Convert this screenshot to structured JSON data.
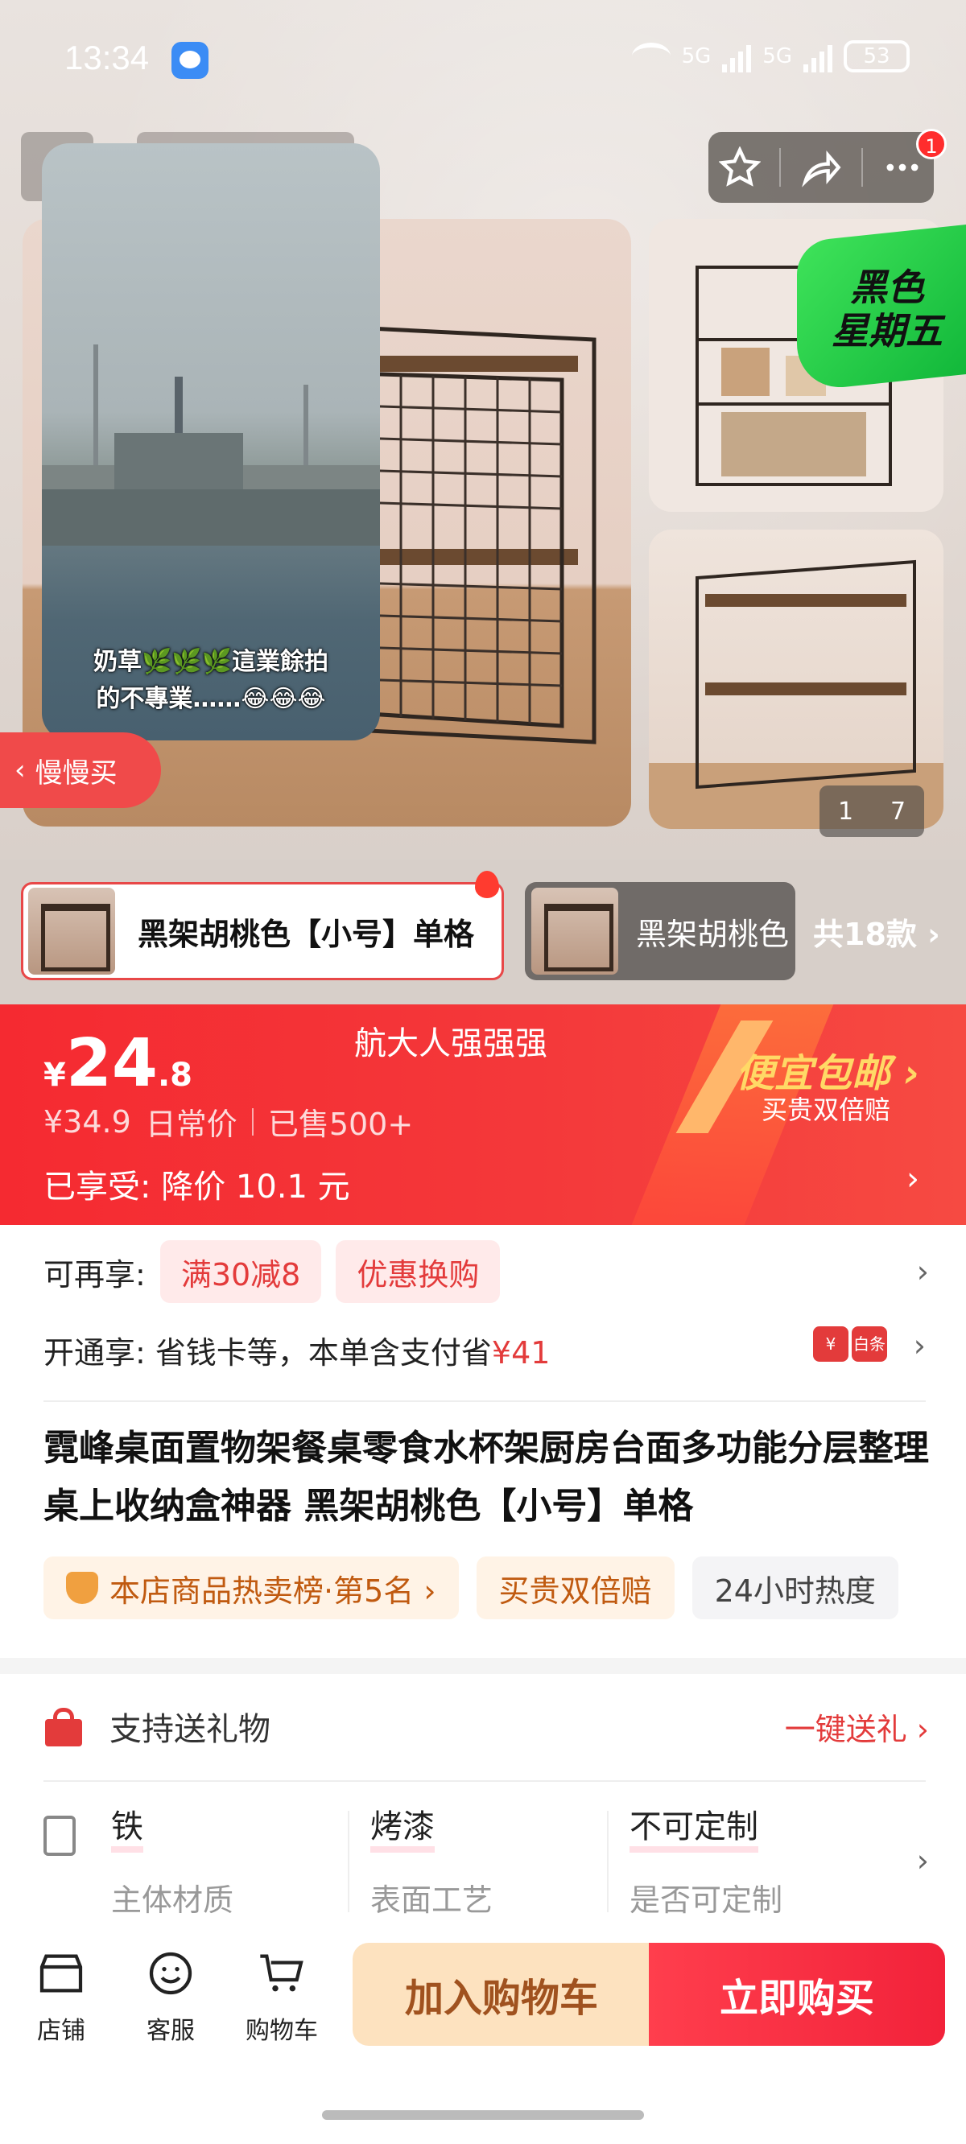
{
  "status_bar": {
    "time": "13:34",
    "network_1": "5G",
    "network_2": "5G",
    "battery": "53"
  },
  "gallery": {
    "notification_count": "1",
    "black_friday_line1": "黑色",
    "black_friday_line2": "星期五",
    "video_caption_line1": "奶草🌿🌿🌿這業餘拍",
    "video_caption_line2": "的不專業……😂😂😂",
    "slow_buy_label": "慢慢买",
    "page_current": "1",
    "page_total": "7"
  },
  "variants": {
    "selected_label": "黑架胡桃色【小号】单格",
    "other_label": "黑架胡桃色",
    "count_label": "共18款"
  },
  "price": {
    "currency": "¥",
    "integer": "24",
    "decimal": ".8",
    "shop_title": "航大人强强强",
    "original_price": "¥34.9",
    "original_label": "日常价",
    "sold_label": "已售500+",
    "enjoyed_label": "已享受: 降价 10.1 元",
    "free_shipping": "便宜包邮",
    "free_shipping_sub": "买贵双倍赔"
  },
  "promos": {
    "label": "可再享:",
    "chips": [
      "满30减8",
      "优惠换购"
    ]
  },
  "open_benefit": {
    "prefix": "开通享: 省钱卡等，本单含支付省",
    "amount": "¥41",
    "icon_1": "¥",
    "icon_2": "白条"
  },
  "product": {
    "title": "霓峰桌面置物架餐桌零食水杯架厨房台面多功能分层整理桌上收纳盒神器 黑架胡桃色【小号】单格",
    "tags": [
      "本店商品热卖榜·第5名 ›",
      "买贵双倍赔",
      "24小时热度"
    ]
  },
  "gift": {
    "label": "支持送礼物",
    "action": "一键送礼 ›"
  },
  "attributes": [
    {
      "value": "铁",
      "key": "主体材质"
    },
    {
      "value": "烤漆",
      "key": "表面工艺"
    },
    {
      "value": "不可定制",
      "key": "是否可定制"
    }
  ],
  "bottom_nav": {
    "store": "店铺",
    "service": "客服",
    "cart": "购物车",
    "add_to_cart": "加入购物车",
    "buy_now": "立即购买"
  },
  "colors": {
    "brand_red": "#f52a31",
    "accent_green": "#12b83a",
    "cart_button": "#fde2bf",
    "buy_button": "#f2223a"
  }
}
